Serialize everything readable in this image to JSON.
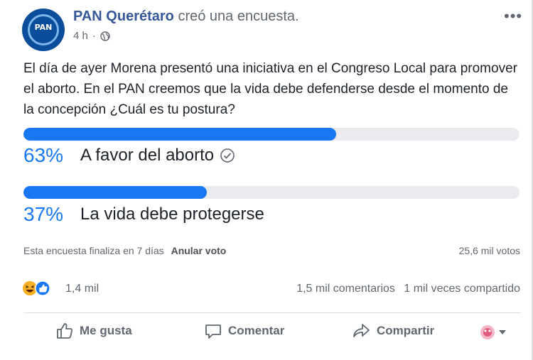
{
  "post": {
    "author": "PAN Querétaro",
    "action": "creó una encuesta.",
    "time": "4 h",
    "separator": "·",
    "text": "El día de ayer Morena presentó una iniciativa en el Congreso Local para promover el aborto. En el PAN creemos que la vida debe defenderse desde el momento de la concepción ¿Cuál es tu postura?"
  },
  "poll": {
    "options": [
      {
        "percent": "63%",
        "label": "A favor del aborto",
        "fill": 0.63,
        "voted": true
      },
      {
        "percent": "37%",
        "label": "La vida debe protegerse",
        "fill": 0.37,
        "voted": false
      }
    ],
    "ends_text": "Esta encuesta finaliza en 7 días",
    "undo_label": "Anular voto",
    "votes_text": "25,6 mil votos"
  },
  "engagement": {
    "reaction_count": "1,4 mil",
    "comments": "1,5 mil comentarios",
    "shares": "1 mil veces compartido"
  },
  "actions": {
    "like": "Me gusta",
    "comment": "Comentar",
    "share": "Compartir"
  },
  "colors": {
    "accent": "#1877f2",
    "author": "#365899",
    "bar_bg": "#e9ebee"
  },
  "icons": [
    "globe-icon",
    "more-options-icon",
    "check-circle-icon",
    "haha-reaction-icon",
    "like-reaction-icon",
    "thumbs-up-icon",
    "comment-icon",
    "share-icon",
    "reaction-picker-icon",
    "chevron-down-icon"
  ]
}
